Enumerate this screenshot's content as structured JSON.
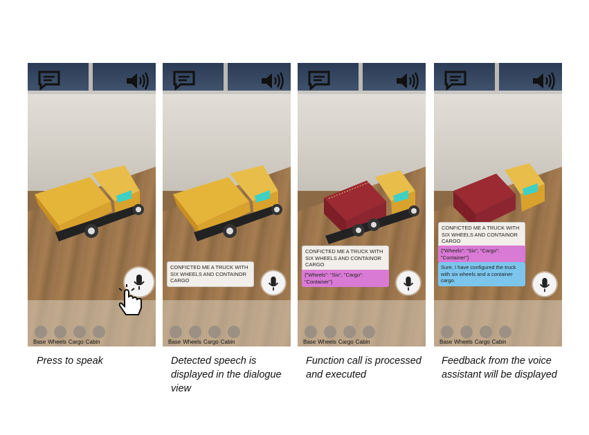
{
  "panels": [
    {
      "caption": "Press to speak",
      "categories": [
        "Base",
        "Wheels",
        "Cargo",
        "Cabin"
      ],
      "bubbles": []
    },
    {
      "caption": "Detected speech is displayed in the dialogue view",
      "categories": [
        "Base",
        "Wheels",
        "Cargo",
        "Cabin"
      ],
      "bubbles": [
        "CONFICTED ME A TRUCK WITH SIX WHEELS AND CONTAINOR CARGO"
      ]
    },
    {
      "caption": "Function call is processed and executed",
      "categories": [
        "Base",
        "Wheels",
        "Cargo",
        "Cabin"
      ],
      "bubbles": [
        "CONFICTED ME A TRUCK WITH SIX WHEELS AND CONTAINOR CARGO",
        "{\"Wheels\": \"Six\", \"Cargo\": \"Container\"}"
      ]
    },
    {
      "caption": "Feedback from the voice assistant will be displayed",
      "categories": [
        "Base",
        "Wheels",
        "Cargo",
        "Cabin"
      ],
      "bubbles": [
        "CONFICTED ME A TRUCK WITH SIX WHEELS AND CONTAINOR CARGO",
        "{\"Wheels\": \"Six\", \"Cargo\": \"Container\"}",
        "Sure, I have configured the truck with six wheels and a container cargo."
      ]
    }
  ],
  "icons": {
    "chat": "chat-icon",
    "speaker": "speaker-icon",
    "mic": "microphone-icon",
    "hand": "hand-pointer-icon"
  },
  "colors": {
    "function_bubble": "#d97ad5",
    "reply_bubble": "#7cc6ee",
    "truck_yellow": "#e5b53a",
    "container_red": "#9b2a33"
  }
}
